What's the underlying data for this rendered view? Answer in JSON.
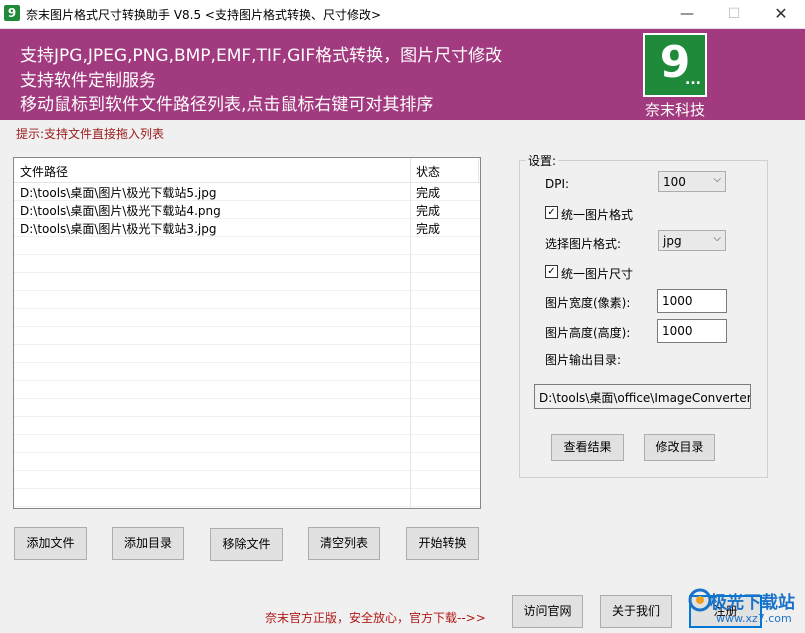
{
  "window": {
    "title": "奈末图片格式尺寸转换助手 V8.5  <支持图片格式转换、尺寸修改>",
    "minimize": "—",
    "maximize": "☐",
    "close": "✕"
  },
  "banner": {
    "line1": "支持JPG,JPEG,PNG,BMP,EMF,TIF,GIF格式转换，图片尺寸修改",
    "line2": "支持软件定制服务",
    "line3": "移动鼠标到软件文件路径列表,点击鼠标右键可对其排序",
    "logo_text": "9",
    "logo_dots": "...",
    "company": "奈末科技",
    "bg_color": "#a23a7f"
  },
  "hint": "提示:支持文件直接拖入列表",
  "file_list": {
    "columns": [
      "文件路径",
      "状态"
    ],
    "rows": [
      {
        "path": "D:\\tools\\桌面\\图片\\极光下载站5.jpg",
        "status": "完成"
      },
      {
        "path": "D:\\tools\\桌面\\图片\\极光下载站4.png",
        "status": "完成"
      },
      {
        "path": "D:\\tools\\桌面\\图片\\极光下载站3.jpg",
        "status": "完成"
      }
    ]
  },
  "settings": {
    "title": "设置:",
    "dpi_label": "DPI:",
    "dpi_value": "100",
    "unify_format_label": "统一图片格式",
    "unify_format_checked": true,
    "format_label": "选择图片格式:",
    "format_value": "jpg",
    "unify_size_label": "统一图片尺寸",
    "unify_size_checked": true,
    "width_label": "图片宽度(像素):",
    "width_value": "1000",
    "height_label": "图片高度(高度):",
    "height_value": "1000",
    "output_label": "图片输出目录:",
    "output_path": "D:\\tools\\桌面\\office\\ImageConverter",
    "view_result": "查看结果",
    "change_dir": "修改目录"
  },
  "actions": {
    "add_file": "添加文件",
    "add_dir": "添加目录",
    "remove_file": "移除文件",
    "clear_list": "清空列表",
    "start_convert": "开始转换"
  },
  "footer": {
    "text": "奈末官方正版，安全放心，官方下载-->>",
    "visit_site": "访问官网",
    "about": "关于我们",
    "register": "注册"
  },
  "watermark": {
    "text": "极光下载站",
    "sub": "www.xz7.com"
  }
}
